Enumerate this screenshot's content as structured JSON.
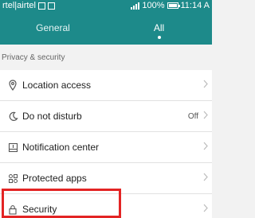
{
  "status_bar": {
    "carrier": "rtel|airtel",
    "battery": "100%",
    "time": "11:14 A"
  },
  "tabs": [
    {
      "label": "General",
      "active": false
    },
    {
      "label": "All",
      "active": true
    }
  ],
  "section": {
    "title": "Privacy & security"
  },
  "items": [
    {
      "label": "Location access",
      "icon": "location-pin-icon",
      "value": ""
    },
    {
      "label": "Do not disturb",
      "icon": "moon-icon",
      "value": "Off"
    },
    {
      "label": "Notification center",
      "icon": "notification-icon",
      "value": ""
    },
    {
      "label": "Protected apps",
      "icon": "apps-grid-icon",
      "value": ""
    },
    {
      "label": "Security",
      "icon": "lock-icon",
      "value": ""
    }
  ],
  "colors": {
    "accent": "#1d8a8a",
    "highlight": "#e32424"
  }
}
